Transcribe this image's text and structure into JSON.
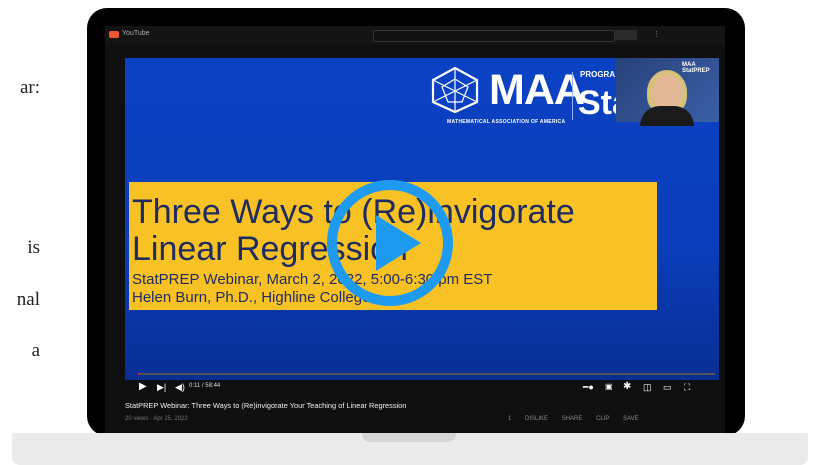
{
  "article": {
    "lines": [
      "ar:",
      "is",
      "nal",
      "a"
    ]
  },
  "youtube": {
    "brand": "YouTube"
  },
  "video": {
    "maa_name": "MAA",
    "maa_subtitle": "MATHEMATICAL ASSOCIATION OF AMERICA",
    "program_small": "PROGRA",
    "program_big": "Sta",
    "camera_label": "MAA StatPREP",
    "slide_title_line1": "Three Ways to (Re)invigorate",
    "slide_title_line2": "Linear Regression",
    "slide_sub_line1": "StatPREP Webinar, March 2, 2022, 5:00-6:30 pm EST",
    "slide_sub_line2": "Helen Burn, Ph.D., Highline College",
    "time": "0:11 / 58:44",
    "progress": 0.003
  },
  "below": {
    "title": "StatPREP Webinar: Three Ways to (Re)invigorate Your Teaching of Linear Regression",
    "meta": "20 views · Apr 25, 2022",
    "actions": [
      "1",
      "DISLIKE",
      "SHARE",
      "CLIP",
      "SAVE"
    ]
  },
  "colors": {
    "video_blue": "#0b42c4",
    "slide_yellow": "#f8c124",
    "play_blue": "#1e9bf0",
    "progress_red": "#e02020"
  }
}
